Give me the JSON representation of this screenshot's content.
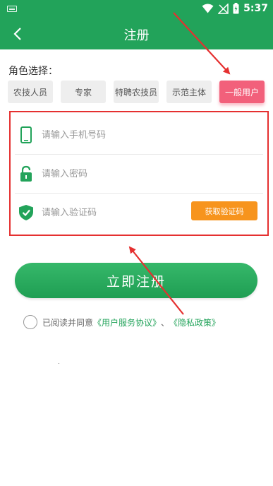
{
  "status_bar": {
    "time": "5:37"
  },
  "header": {
    "title": "注册",
    "back_icon": "back-arrow-icon"
  },
  "roles": {
    "label": "角色选择：",
    "items": [
      {
        "label": "农技人员",
        "selected": false
      },
      {
        "label": "专家",
        "selected": false
      },
      {
        "label": "特聘农技员",
        "selected": false
      },
      {
        "label": "示范主体",
        "selected": false
      },
      {
        "label": "一般用户",
        "selected": true
      }
    ]
  },
  "form": {
    "phone_placeholder": "请输入手机号码",
    "password_placeholder": "请输入密码",
    "code_placeholder": "请输入验证码",
    "get_code_label": "获取验证码"
  },
  "register_button": "立即注册",
  "agreement": {
    "prefix": "已阅读并同意",
    "user_service": "《用户服务协议》",
    "separator": "、",
    "privacy": "《隐私政策》"
  },
  "colors": {
    "primary_green": "#22a35a",
    "selected_role": "#f2607b",
    "code_button": "#f7941d",
    "annotation_red": "#e53030"
  }
}
